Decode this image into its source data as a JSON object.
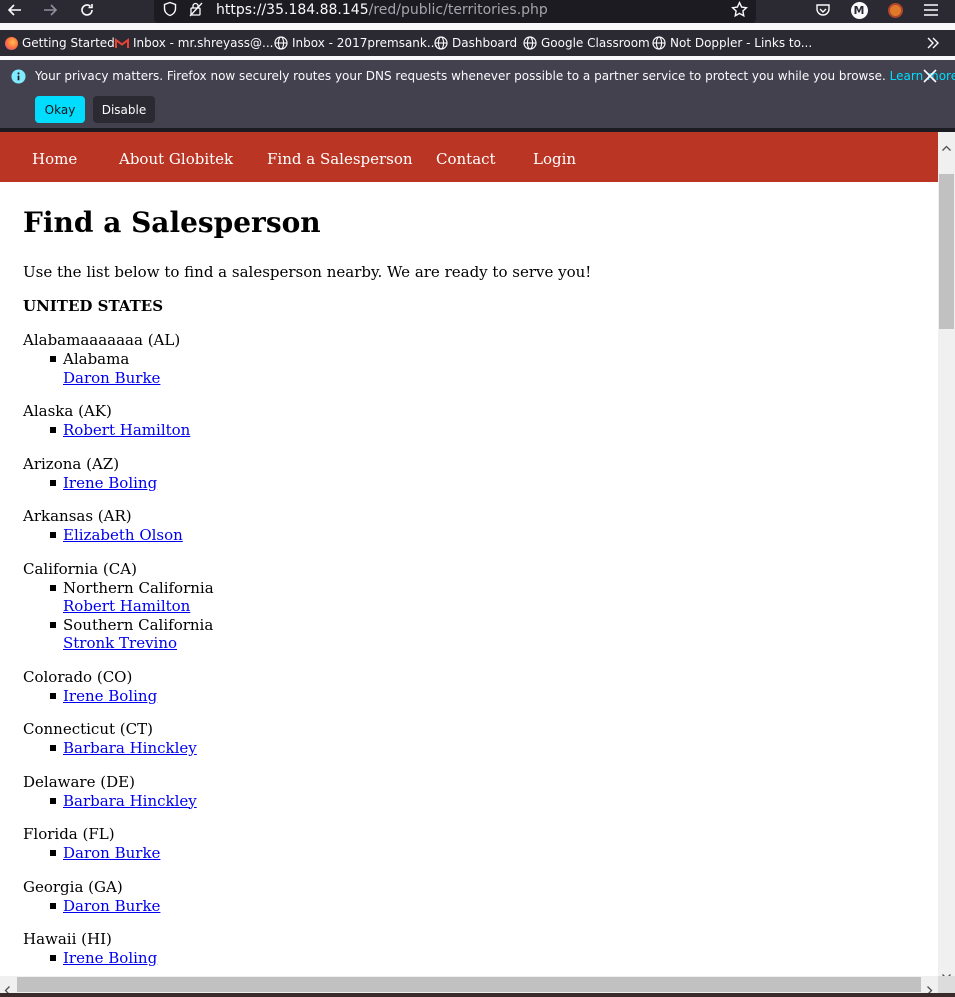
{
  "browser": {
    "url_host": "https://35.184.88.145",
    "url_path": "/red/public/territories.php",
    "bookmarks": [
      {
        "label": "Getting Started",
        "icon": "firefox-icon"
      },
      {
        "label": "Inbox - mr.shreyass@...",
        "icon": "gmail-icon"
      },
      {
        "label": "Inbox - 2017premsank...",
        "icon": "globe-icon"
      },
      {
        "label": "Dashboard",
        "icon": "globe-icon"
      },
      {
        "label": "Google Classroom",
        "icon": "globe-icon"
      },
      {
        "label": "Not Doppler - Links to...",
        "icon": "globe-icon"
      }
    ],
    "notification": {
      "text": "Your privacy matters. Firefox now securely routes your DNS requests whenever possible to a partner service to protect you while you browse.",
      "link": "Learn more",
      "okay": "Okay",
      "disable": "Disable"
    },
    "profile_initial": "M"
  },
  "site": {
    "nav": [
      "Home",
      "About Globitek",
      "Find a Salesperson",
      "Contact",
      "Login"
    ],
    "title": "Find a Salesperson",
    "intro": "Use the list below to find a salesperson nearby. We are ready to serve you!",
    "country": "UNITED STATES",
    "states": [
      {
        "name": "Alabamaaaaaaa (AL)",
        "territories": [
          {
            "region": "Alabama",
            "salesperson": "Daron Burke"
          }
        ]
      },
      {
        "name": "Alaska (AK)",
        "territories": [
          {
            "region": "",
            "salesperson": "Robert Hamilton"
          }
        ]
      },
      {
        "name": "Arizona (AZ)",
        "territories": [
          {
            "region": "",
            "salesperson": "Irene Boling"
          }
        ]
      },
      {
        "name": "Arkansas (AR)",
        "territories": [
          {
            "region": "",
            "salesperson": "Elizabeth Olson"
          }
        ]
      },
      {
        "name": "California (CA)",
        "territories": [
          {
            "region": "Northern California",
            "salesperson": "Robert Hamilton"
          },
          {
            "region": "Southern California",
            "salesperson": "Stronk Trevino"
          }
        ]
      },
      {
        "name": "Colorado (CO)",
        "territories": [
          {
            "region": "",
            "salesperson": "Irene Boling"
          }
        ]
      },
      {
        "name": "Connecticut (CT)",
        "territories": [
          {
            "region": "",
            "salesperson": "Barbara Hinckley"
          }
        ]
      },
      {
        "name": "Delaware (DE)",
        "territories": [
          {
            "region": "",
            "salesperson": "Barbara Hinckley"
          }
        ]
      },
      {
        "name": "Florida (FL)",
        "territories": [
          {
            "region": "",
            "salesperson": "Daron Burke"
          }
        ]
      },
      {
        "name": "Georgia (GA)",
        "territories": [
          {
            "region": "",
            "salesperson": "Daron Burke"
          }
        ]
      },
      {
        "name": "Hawaii (HI)",
        "territories": [
          {
            "region": "",
            "salesperson": "Irene Boling"
          }
        ]
      }
    ]
  },
  "colors": {
    "nav_bg": "#bb3524",
    "link": "#0000ee",
    "chrome_bg": "#2b2a33",
    "accent": "#00ddff"
  }
}
